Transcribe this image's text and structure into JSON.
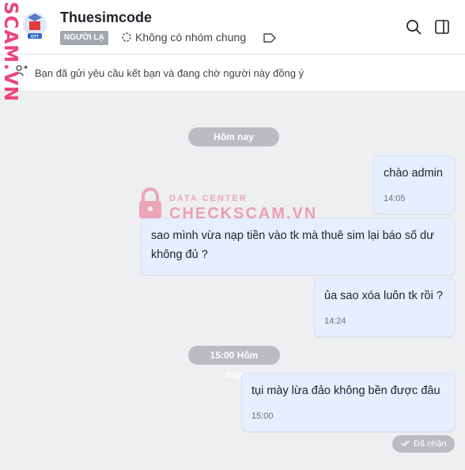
{
  "header": {
    "title": "Thuesimcode",
    "stranger_badge": "NGƯỜI LẠ",
    "group_text": "Không có nhóm chung",
    "avatar_text": "DTT"
  },
  "notice": {
    "text": "Bạn đã gửi yêu cầu kết bạn và đang chờ người này đồng ý"
  },
  "watermark": {
    "vertical": "SCAM.VN",
    "data_center": "DATA CENTER",
    "brand": "CHECKSCAM.VN",
    "color": "#ee4379"
  },
  "messages": {
    "day_1": "Hôm nay",
    "m1": {
      "text": "chào admin",
      "time": "14:05"
    },
    "m2": {
      "text": "sao mình vừa nạp tiền vào tk mà thuê sim lại báo số dư không đủ ?"
    },
    "m3": {
      "text": "ủa sao xóa luôn tk rồi ?",
      "time": "14:24"
    },
    "day_2": "15:00 Hôm nay",
    "m4": {
      "text": "tụi mày lừa đảo không bền được đâu",
      "time": "15:00"
    },
    "status": "Đã nhận"
  },
  "colors": {
    "bubble": "#e5efff",
    "chat_bg": "#eeeff1",
    "separator": "#babcc1"
  },
  "icons": [
    "search-icon",
    "split-view-icon",
    "tag-icon",
    "group-icon",
    "friend-request-icon",
    "double-check-icon"
  ]
}
